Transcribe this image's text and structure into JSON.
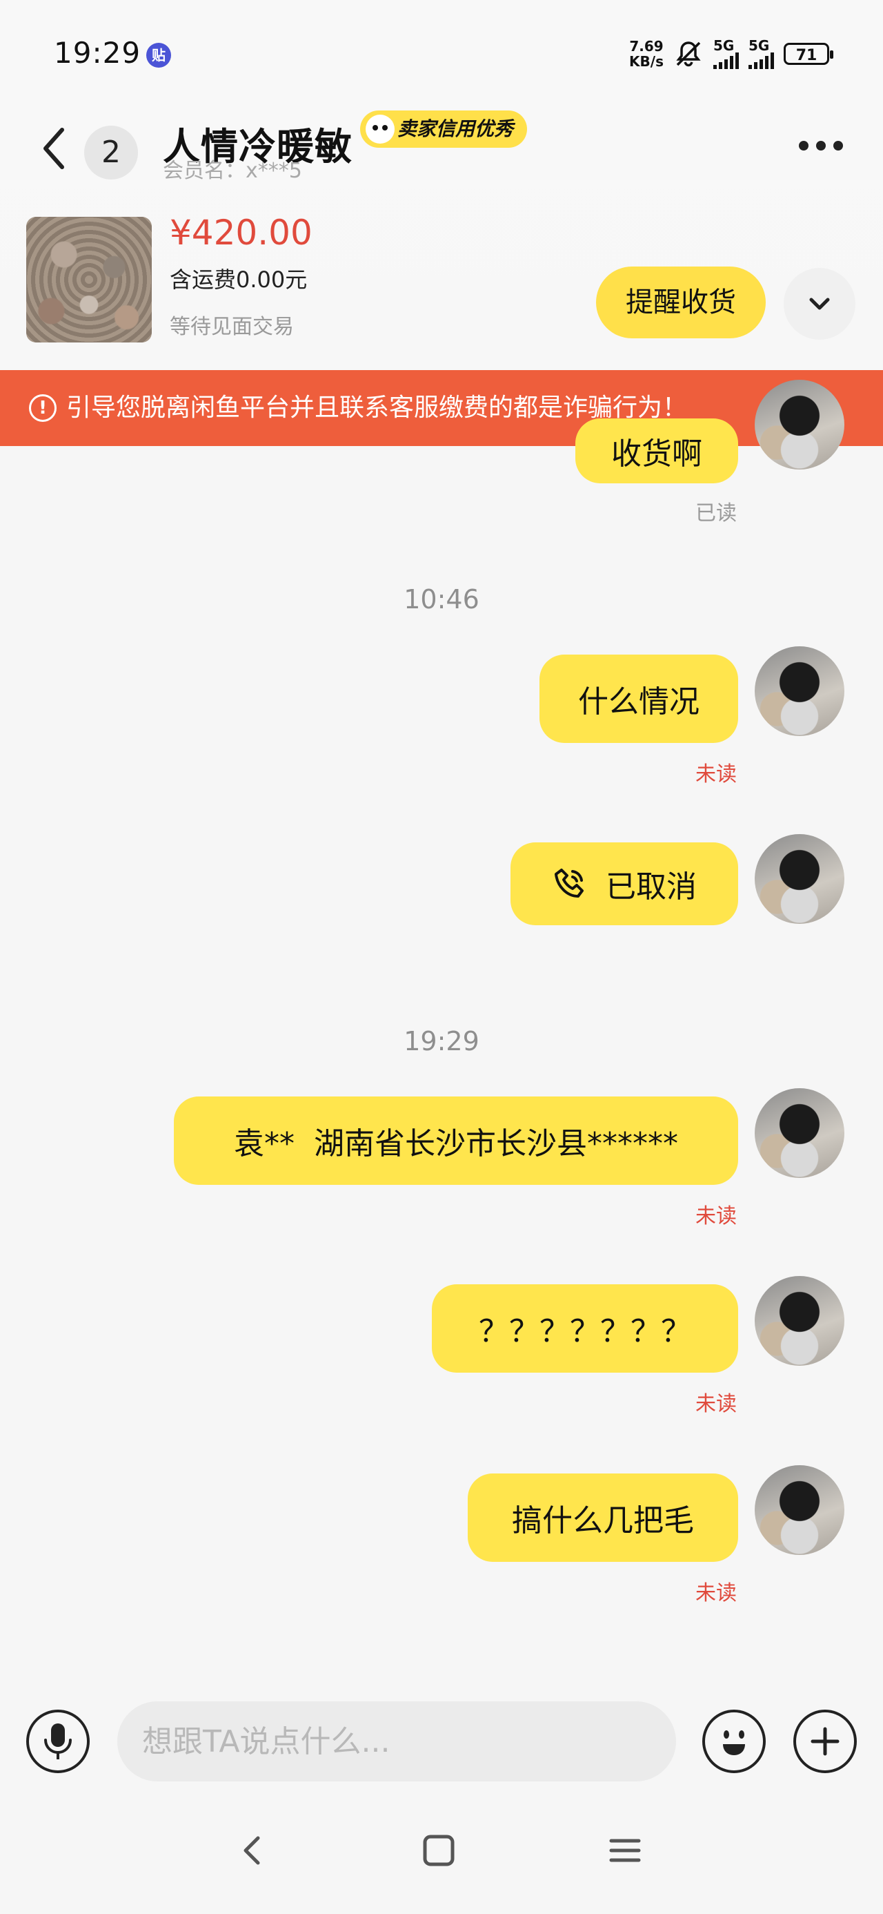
{
  "status_bar": {
    "time": "19:29",
    "app_badge": "贴",
    "net_speed_value": "7.69",
    "net_speed_unit": "KB/s",
    "sim1_label": "5G",
    "sim2_label": "5G",
    "battery": "71",
    "icons": [
      "mute-bell-icon",
      "signal-icon",
      "battery-icon"
    ]
  },
  "header": {
    "unread_count": "2",
    "contact_name": "人情冷暖敏",
    "credit_badge": "卖家信用优秀",
    "member_id": "会员名：x***5"
  },
  "product": {
    "price": "¥420.00",
    "shipping": "含运费0.00元",
    "trade_status": "等待见面交易",
    "remind_button": "提醒收货"
  },
  "warning": {
    "icon": "!",
    "text": "引导您脱离闲鱼平台并且联系客服缴费的都是诈骗行为！"
  },
  "messages": {
    "partial_top_text": "收货啊",
    "partial_top_status": "已读",
    "time_1": "10:46",
    "msg_1_text": "什么情况",
    "msg_1_status": "未读",
    "msg_2_text": "已取消",
    "time_2": "19:29",
    "msg_3_text": "袁**  湖南省长沙市长沙县******",
    "msg_3_status": "未读",
    "msg_4_text": "？？？？？？？",
    "msg_4_status": "未读",
    "msg_5_text": "搞什么几把毛",
    "msg_5_status": "未读"
  },
  "input_bar": {
    "placeholder": "想跟TA说点什么..."
  },
  "colors": {
    "accent_yellow": "#ffe54d",
    "warning_red": "#ee5e3c",
    "price_red": "#e04a3c"
  }
}
